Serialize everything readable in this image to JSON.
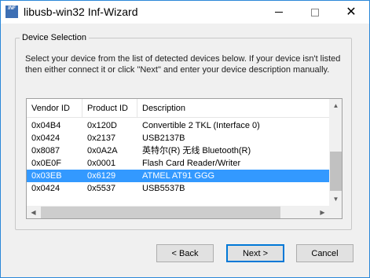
{
  "window": {
    "title": "libusb-win32 Inf-Wizard",
    "icon_text": "INF",
    "minimize_icon": "minimize-icon",
    "maximize_icon": "maximize-icon",
    "close_icon": "close-icon",
    "close_glyph": "✕"
  },
  "group": {
    "label": "Device Selection",
    "instructions": "Select your device from the list of detected devices below. If your device isn't listed then either connect it or click \"Next\" and enter your device description manually."
  },
  "table": {
    "columns": [
      "Vendor ID",
      "Product ID",
      "Description"
    ],
    "rows": [
      {
        "vendor": "0x04B4",
        "product": "0x120D",
        "description": "Convertible 2 TKL (Interface 0)",
        "selected": false
      },
      {
        "vendor": "0x0424",
        "product": "0x2137",
        "description": "USB2137B",
        "selected": false
      },
      {
        "vendor": "0x8087",
        "product": "0x0A2A",
        "description": "英特尔(R) 无线 Bluetooth(R)",
        "selected": false
      },
      {
        "vendor": "0x0E0F",
        "product": "0x0001",
        "description": "Flash Card Reader/Writer",
        "selected": false
      },
      {
        "vendor": "0x03EB",
        "product": "0x6129",
        "description": "ATMEL AT91 GGG",
        "selected": true
      },
      {
        "vendor": "0x0424",
        "product": "0x5537",
        "description": "USB5537B",
        "selected": false
      }
    ]
  },
  "buttons": {
    "back": "< Back",
    "next": "Next >",
    "cancel": "Cancel"
  },
  "colors": {
    "selection": "#3399ff",
    "accent": "#0078d7"
  }
}
